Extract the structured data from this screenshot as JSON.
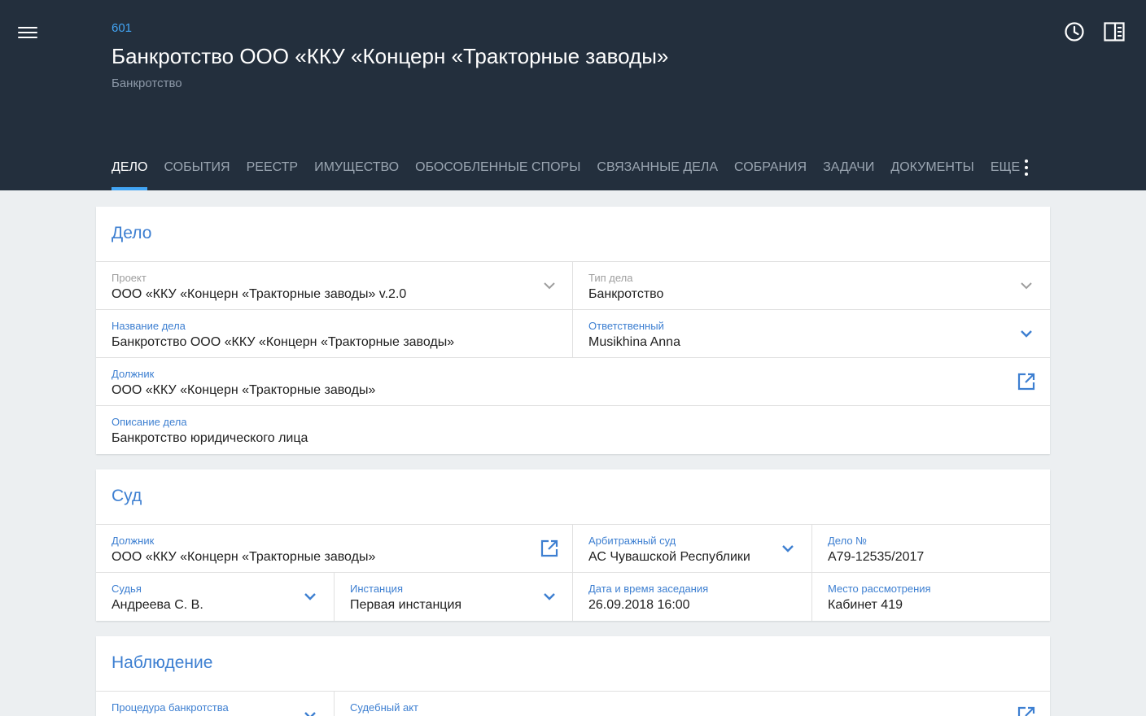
{
  "header": {
    "case_number": "601",
    "title": "Банкротство ООО «ККУ «Концерн «Тракторные заводы»",
    "subtitle": "Банкротство",
    "icons": {
      "menu": "menu-icon",
      "history": "clock-icon",
      "panel": "side-panel-icon",
      "more": "more-vertical-icon"
    }
  },
  "tabs": [
    {
      "label": "ДЕЛО",
      "active": true
    },
    {
      "label": "СОБЫТИЯ"
    },
    {
      "label": "РЕЕСТР"
    },
    {
      "label": "ИМУЩЕСТВО"
    },
    {
      "label": "ОБОСОБЛЕННЫЕ СПОРЫ"
    },
    {
      "label": "СВЯЗАННЫЕ ДЕЛА"
    },
    {
      "label": "СОБРАНИЯ"
    },
    {
      "label": "ЗАДАЧИ"
    },
    {
      "label": "ДОКУМЕНТЫ"
    },
    {
      "label": "ЕЩЕ"
    }
  ],
  "sections": {
    "case": {
      "title": "Дело",
      "project": {
        "label": "Проект",
        "value": "ООО «ККУ «Концерн «Тракторные заводы» v.2.0"
      },
      "case_type": {
        "label": "Тип дела",
        "value": "Банкротство"
      },
      "case_name": {
        "label": "Название дела",
        "value": "Банкротство ООО «ККУ «Концерн «Тракторные заводы»"
      },
      "responsible": {
        "label": "Ответственный",
        "value": "Musikhina Anna"
      },
      "debtor": {
        "label": "Должник",
        "value": "ООО «ККУ «Концерн «Тракторные заводы»"
      },
      "description": {
        "label": "Описание дела",
        "value": "Банкротство юридического лица"
      }
    },
    "court": {
      "title": "Суд",
      "debtor": {
        "label": "Должник",
        "value": "ООО «ККУ «Концерн «Тракторные заводы»"
      },
      "arbitration_court": {
        "label": "Арбитражный суд",
        "value": "АС Чувашской Республики"
      },
      "case_no": {
        "label": "Дело №",
        "value": "А79-12535/2017"
      },
      "judge": {
        "label": "Судья",
        "value": "Андреева С. В."
      },
      "instance": {
        "label": "Инстанция",
        "value": "Первая инстанция"
      },
      "hearing_datetime": {
        "label": "Дата и время заседания",
        "value": "26.09.2018 16:00"
      },
      "venue": {
        "label": "Место рассмотрения",
        "value": "Кабинет 419"
      }
    },
    "observation": {
      "title": "Наблюдение",
      "procedure": {
        "label": "Процедура банкротства"
      },
      "court_act": {
        "label": "Судебный акт"
      }
    }
  },
  "colors": {
    "header_bg": "#232f3d",
    "accent": "#42a5f5",
    "link_blue": "#3d7fd1",
    "page_bg": "#eceff1"
  }
}
